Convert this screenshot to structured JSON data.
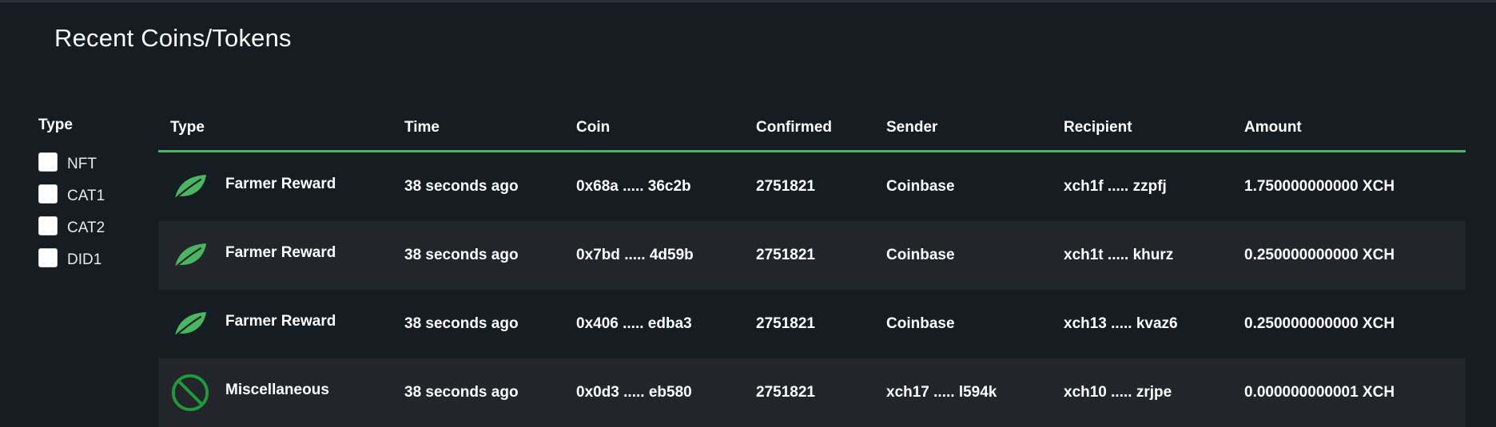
{
  "page": {
    "title": "Recent Coins/Tokens"
  },
  "filter": {
    "title": "Type",
    "options": [
      {
        "label": "NFT",
        "checked": false
      },
      {
        "label": "CAT1",
        "checked": false
      },
      {
        "label": "CAT2",
        "checked": false
      },
      {
        "label": "DID1",
        "checked": false
      }
    ]
  },
  "table": {
    "headers": {
      "type": "Type",
      "time": "Time",
      "coin": "Coin",
      "confirmed": "Confirmed",
      "sender": "Sender",
      "recipient": "Recipient",
      "amount": "Amount"
    },
    "rows": [
      {
        "type": "Farmer Reward",
        "icon": "leaf-icon",
        "time": "38 seconds ago",
        "coin": "0x68a ..... 36c2b",
        "confirmed": "2751821",
        "sender": "Coinbase",
        "recipient": "xch1f ..... zzpfj",
        "amount": "1.750000000000 XCH"
      },
      {
        "type": "Farmer Reward",
        "icon": "leaf-icon",
        "time": "38 seconds ago",
        "coin": "0x7bd ..... 4d59b",
        "confirmed": "2751821",
        "sender": "Coinbase",
        "recipient": "xch1t ..... khurz",
        "amount": "0.250000000000 XCH"
      },
      {
        "type": "Farmer Reward",
        "icon": "leaf-icon",
        "time": "38 seconds ago",
        "coin": "0x406 ..... edba3",
        "confirmed": "2751821",
        "sender": "Coinbase",
        "recipient": "xch13 ..... kvaz6",
        "amount": "0.250000000000 XCH"
      },
      {
        "type": "Miscellaneous",
        "icon": "prohibited-icon",
        "time": "38 seconds ago",
        "coin": "0x0d3 ..... eb580",
        "confirmed": "2751821",
        "sender": "xch17 ..... l594k",
        "recipient": "xch10 ..... zrjpe",
        "amount": "0.000000000001 XCH"
      }
    ]
  },
  "colors": {
    "background": "#151c22",
    "accent": "#4bb562",
    "alt_row": "#22262b"
  }
}
